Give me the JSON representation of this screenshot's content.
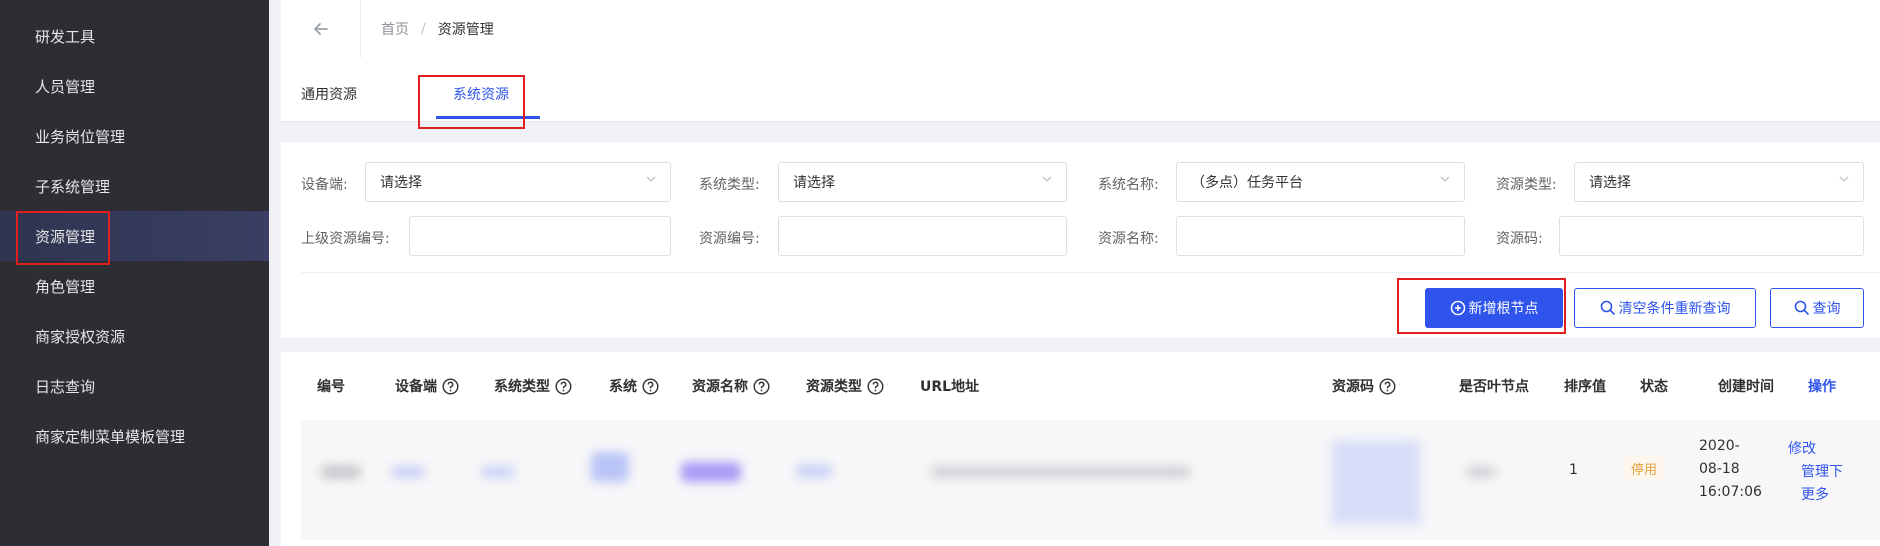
{
  "sidebar": {
    "items": [
      {
        "label": "研发工具"
      },
      {
        "label": "人员管理"
      },
      {
        "label": "业务岗位管理"
      },
      {
        "label": "子系统管理"
      },
      {
        "label": "资源管理"
      },
      {
        "label": "角色管理"
      },
      {
        "label": "商家授权资源"
      },
      {
        "label": "日志查询"
      },
      {
        "label": "商家定制菜单模板管理"
      }
    ],
    "active": "资源管理"
  },
  "breadcrumb": {
    "home": "首页",
    "separator": "/",
    "current": "资源管理"
  },
  "tabs": [
    {
      "label": "通用资源"
    },
    {
      "label": "系统资源"
    }
  ],
  "filters": {
    "device": {
      "label": "设备端:",
      "value": "请选择"
    },
    "system_type": {
      "label": "系统类型:",
      "value": "请选择"
    },
    "system_name": {
      "label": "系统名称:",
      "value": "（多点）任务平台"
    },
    "resource_type": {
      "label": "资源类型:",
      "value": "请选择"
    },
    "parent_code": {
      "label": "上级资源编号:",
      "value": ""
    },
    "resource_no": {
      "label": "资源编号:",
      "value": ""
    },
    "resource_name": {
      "label": "资源名称:",
      "value": ""
    },
    "resource_code": {
      "label": "资源码:",
      "value": ""
    }
  },
  "buttons": {
    "add_root": "新增根节点",
    "clear_query": "清空条件重新查询",
    "query": "查询"
  },
  "table": {
    "headers": [
      "编号",
      "设备端",
      "系统类型",
      "系统",
      "资源名称",
      "资源类型",
      "URL地址",
      "资源码",
      "是否叶节点",
      "排序值",
      "状态",
      "创建时间",
      "操作"
    ],
    "row": {
      "sort": "1",
      "status": "停用",
      "created_date": "2020-",
      "created_date2": "08-18",
      "created_time": "16:07:06",
      "actions": [
        "修改",
        "管理下",
        "更多"
      ]
    }
  },
  "colors": {
    "accent": "#2f54eb",
    "sidebar_bg": "#2c2e33",
    "highlight": "#e02020",
    "warning": "#e6a23c"
  }
}
